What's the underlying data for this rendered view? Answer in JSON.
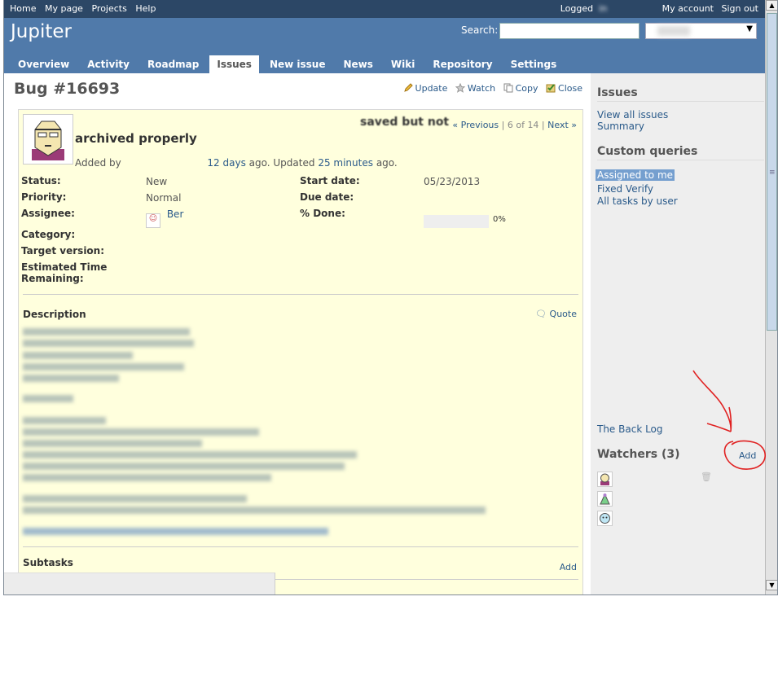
{
  "top_menu": {
    "links": [
      "Home",
      "My page",
      "Projects",
      "Help"
    ],
    "logged_in": "Logged",
    "my_account": "My account",
    "sign_out": "Sign out"
  },
  "header": {
    "title": "Jupiter",
    "search_label": "Search:",
    "search_value": ""
  },
  "tabs": [
    {
      "label": "Overview"
    },
    {
      "label": "Activity"
    },
    {
      "label": "Roadmap"
    },
    {
      "label": "Issues",
      "selected": true
    },
    {
      "label": "New issue"
    },
    {
      "label": "News"
    },
    {
      "label": "Wiki"
    },
    {
      "label": "Repository"
    },
    {
      "label": "Settings"
    }
  ],
  "issue": {
    "heading": "Bug #16693",
    "actions": {
      "update": "Update",
      "watch": "Watch",
      "copy": "Copy",
      "close": "Close"
    },
    "saved_text": "saved but not",
    "nav": {
      "previous": "« Previous",
      "position": "| 6 of 14 |",
      "next": "Next »"
    },
    "subject": "archived properly",
    "added_by": "Added by",
    "created_ago": "12 days",
    "ago_updated": "ago. Updated",
    "updated_ago": "25 minutes",
    "ago": "ago.",
    "status_label": "Status:",
    "status": "New",
    "priority_label": "Priority:",
    "priority": "Normal",
    "assignee_label": "Assignee:",
    "assignee": "Ber",
    "category_label": "Category:",
    "target_label": "Target version:",
    "estimated_label_1": "Estimated Time",
    "estimated_label_2": "Remaining:",
    "start_label": "Start date:",
    "start": "05/23/2013",
    "due_label": "Due date:",
    "done_label": "% Done:",
    "done_value": "0%",
    "done_fraction": 0,
    "description_title": "Description",
    "quote": "Quote",
    "subtasks_title": "Subtasks",
    "subtasks_add": "Add"
  },
  "sidebar": {
    "issues_title": "Issues",
    "view_all": "View all issues",
    "summary": "Summary",
    "custom_queries_title": "Custom queries",
    "queries": [
      "Assigned to me",
      "Fixed Verify",
      "All tasks by user"
    ],
    "back_log": "The Back Log",
    "watchers_title": "Watchers (3)",
    "watchers_add": "Add"
  }
}
